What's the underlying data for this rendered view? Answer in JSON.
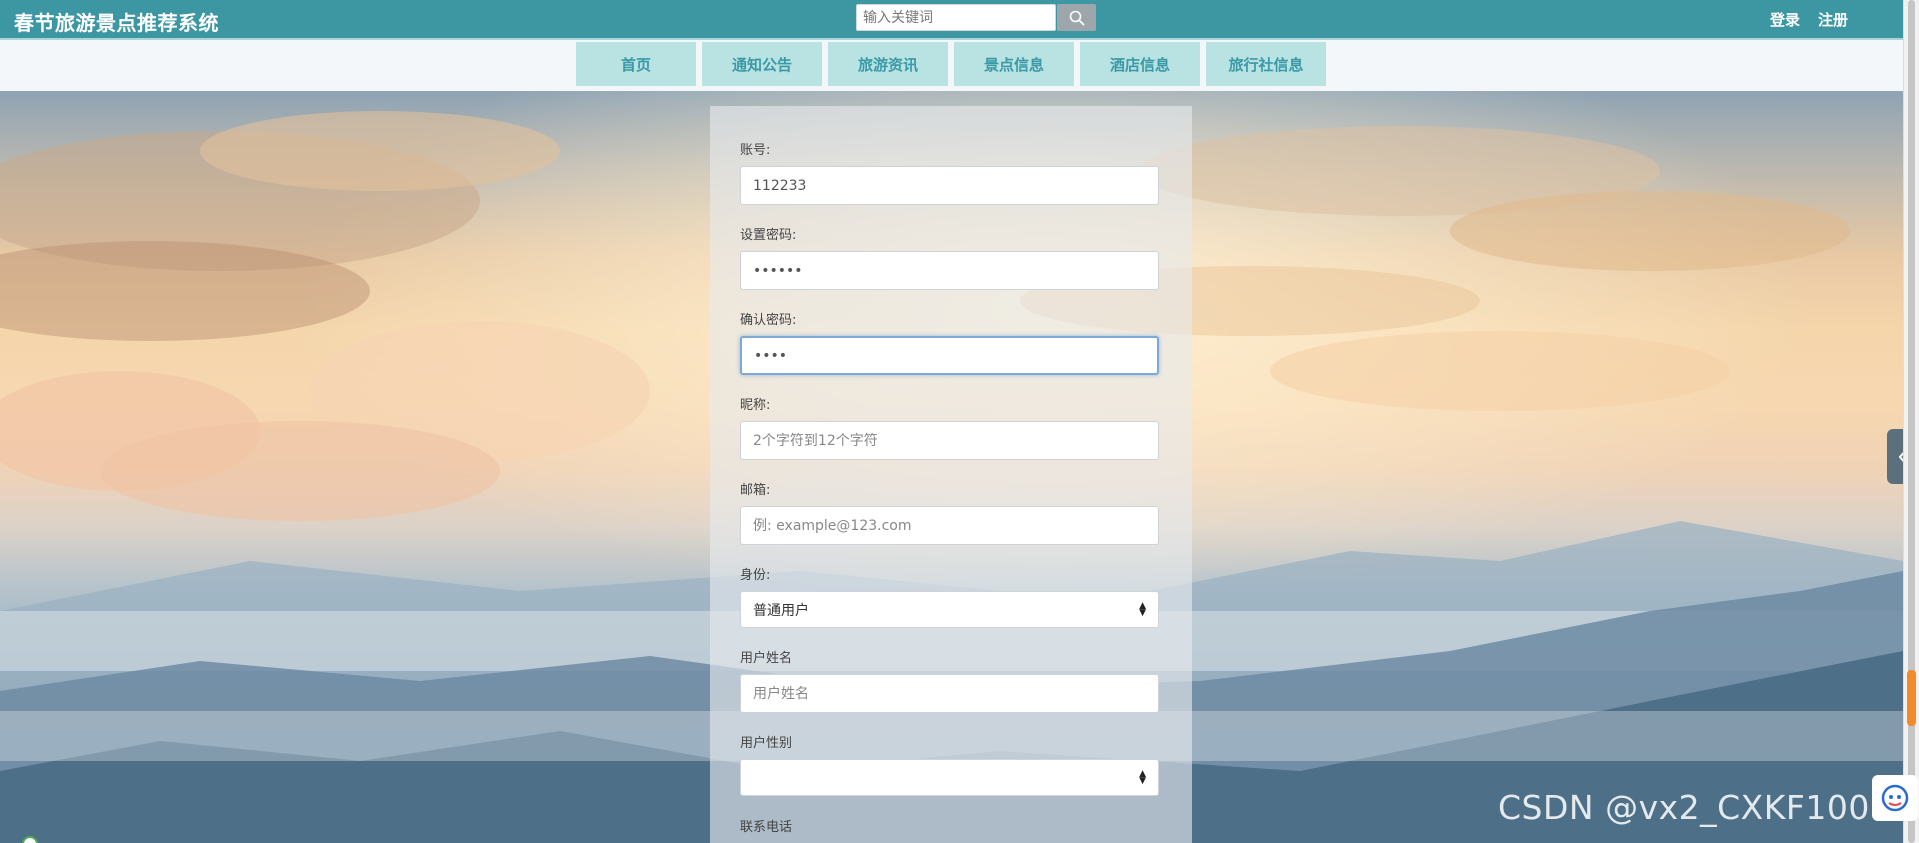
{
  "header": {
    "title": "春节旅游景点推荐系统",
    "search_placeholder": "输入关键词",
    "login_label": "登录",
    "register_label": "注册"
  },
  "nav": {
    "items": [
      {
        "label": "首页"
      },
      {
        "label": "通知公告"
      },
      {
        "label": "旅游资讯"
      },
      {
        "label": "景点信息"
      },
      {
        "label": "酒店信息"
      },
      {
        "label": "旅行社信息"
      }
    ]
  },
  "form": {
    "account": {
      "label": "账号:",
      "value": "112233"
    },
    "password": {
      "label": "设置密码:",
      "value": "••••••"
    },
    "confirm_password": {
      "label": "确认密码:",
      "value": "••••"
    },
    "nickname": {
      "label": "昵称:",
      "placeholder": "2个字符到12个字符"
    },
    "email": {
      "label": "邮箱:",
      "placeholder": "例: example@123.com"
    },
    "identity": {
      "label": "身份:",
      "selected": "普通用户"
    },
    "real_name": {
      "label": "用户姓名",
      "placeholder": "用户姓名"
    },
    "gender": {
      "label": "用户性别",
      "selected": ""
    },
    "phone": {
      "label": "联系电话"
    }
  },
  "watermark": "CSDN @vx2_CXKF1000",
  "icons": {
    "search": "search-icon",
    "side_tab": "chevron-left-icon",
    "select_arrow": "sort-arrows-icon"
  },
  "colors": {
    "header_bg": "#3d97a3",
    "nav_item_bg": "#b9e2e2",
    "nav_text": "#3a9aa6"
  }
}
